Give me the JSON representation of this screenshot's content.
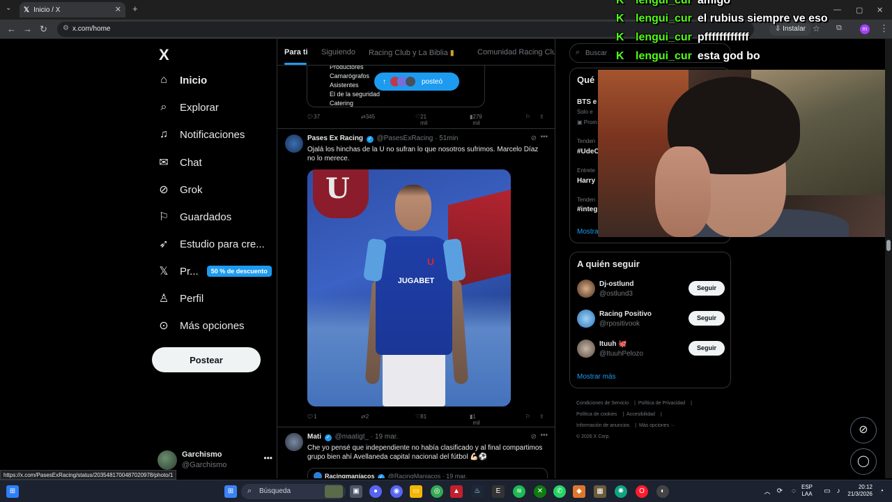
{
  "browser": {
    "tab_title": "Inicio / X",
    "url": "x.com/home",
    "install_label": "Instalar",
    "profile_initial": "m",
    "status_url": "https://x.com/PasesExRacing/status/2035481700487020978/photo/1"
  },
  "nav": {
    "logo": "X",
    "items": [
      {
        "label": "Inicio",
        "icon": "home-icon"
      },
      {
        "label": "Explorar",
        "icon": "search-icon"
      },
      {
        "label": "Notificaciones",
        "icon": "bell-icon"
      },
      {
        "label": "Chat",
        "icon": "mail-icon"
      },
      {
        "label": "Grok",
        "icon": "grok-icon"
      },
      {
        "label": "Guardados",
        "icon": "bookmark-icon"
      },
      {
        "label": "Estudio para cre...",
        "icon": "rocket-icon"
      },
      {
        "label": "Pr...",
        "icon": "x-premium-icon"
      },
      {
        "label": "Perfil",
        "icon": "person-icon"
      },
      {
        "label": "Más opciones",
        "icon": "more-circle-icon"
      }
    ],
    "premium_badge": "50 % de descuento",
    "post_button": "Postear",
    "account_name": "Garchismo",
    "account_handle": "@Garchismo"
  },
  "timeline": {
    "tabs": [
      "Para ti",
      "Siguiendo",
      "Racing Club y La Biblia",
      "Comunidad Racing Club"
    ],
    "prev_card_lines": [
      "Productores",
      "Camarógrafos",
      "Asistentes",
      "El de la seguridad",
      "Catering"
    ],
    "posted_pill": "posteó",
    "prev_actions": {
      "replies": "37",
      "reposts": "345",
      "likes": "21 mil",
      "views": "279 mil"
    },
    "post1": {
      "name": "Pases Ex Racing",
      "handle": "@PasesExRacing",
      "time": "· 51min",
      "text": "Ojalá los hinchas de la U no sufran lo que nosotros sufrimos. Marcelo Díaz no lo merece.",
      "photo_sponsor": "JUGABET",
      "photo_crest": "U",
      "actions": {
        "replies": "1",
        "reposts": "2",
        "likes": "81",
        "views": "1 mil"
      }
    },
    "post2": {
      "name": "Mati",
      "handle": "@maatigt_",
      "time": "· 19 mar.",
      "text": "Che yo pensé que independiente no había clasificado y al final compartimos grupo bien ahí Avellaneda capital nacional del fútbol 💪🏻⚽",
      "quote_name": "Racingmaníacos",
      "quote_handle": "@RacingManiacos · 19 mar."
    }
  },
  "right": {
    "search_placeholder": "Buscar",
    "trends_title": "Qué",
    "trends": [
      {
        "small": "",
        "big": "BTS e"
      },
      {
        "small": "Solo e",
        "big": ""
      },
      {
        "small": "Prom",
        "big": ""
      },
      {
        "small": "Tenden",
        "big": "#UdeC"
      },
      {
        "small": "Entrete",
        "big": "Harry"
      },
      {
        "small": "Tenden",
        "big": "#integ"
      }
    ],
    "trends_more": "Mostra",
    "who_to_follow_title": "A quién seguir",
    "follow": [
      {
        "name": "Dj-ostlund",
        "handle": "@ostlund3",
        "button": "Seguir"
      },
      {
        "name": "Racing Positivo",
        "handle": "@rpositivook",
        "button": "Seguir"
      },
      {
        "name": "Ituuh 🐙",
        "handle": "@ItuuhPelozo",
        "button": "Seguir"
      }
    ],
    "show_more": "Mostrar más",
    "footer": [
      "Condiciones de Servicio",
      "Política de Privacidad",
      "Política de cookies",
      "Accesibilidad",
      "Información de anuncios",
      "Más opciones ···",
      "© 2026 X Corp."
    ]
  },
  "chat": [
    {
      "user": "lengui_cur",
      "msg": "amigo"
    },
    {
      "user": "lengui_cur",
      "msg": "el rubius siempre ve eso"
    },
    {
      "user": "lengui_cur",
      "msg": "pffffffffffff"
    },
    {
      "user": "lengui_cur",
      "msg": "esta god bo"
    }
  ],
  "taskbar": {
    "search_label": "Búsqueda",
    "lang_1": "ESP",
    "lang_2": "LAA",
    "time": "20:12",
    "date": "21/3/2026"
  }
}
